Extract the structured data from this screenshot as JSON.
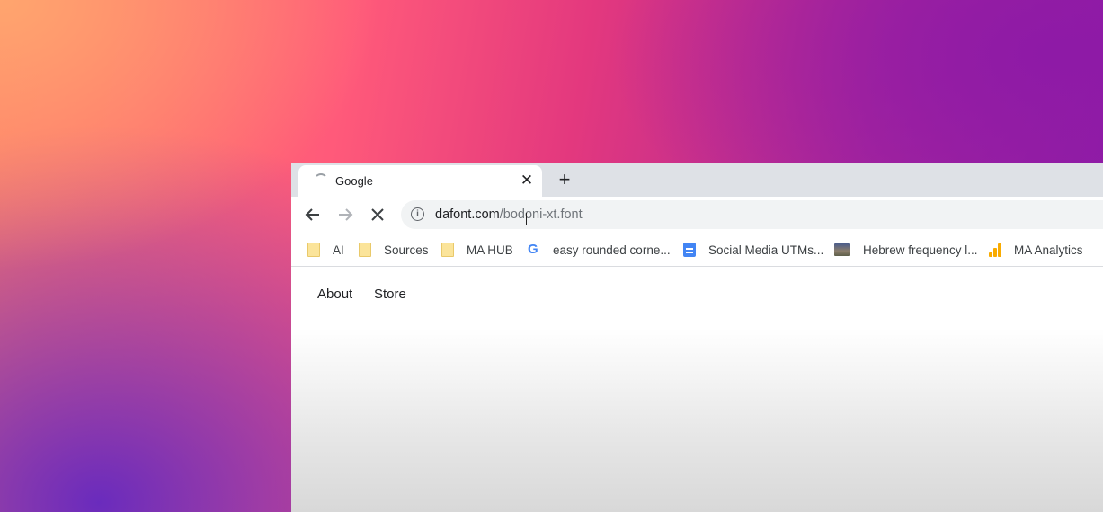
{
  "tab": {
    "title": "Google",
    "close_icon": "close-icon",
    "new_tab_icon": "plus-icon"
  },
  "toolbar": {
    "back_icon": "arrow-left-icon",
    "forward_icon": "arrow-right-icon",
    "stop_icon": "stop-loading-icon"
  },
  "omnibox": {
    "info_icon": "info-icon",
    "host": "dafont.com",
    "path": "/bodoni-xt.font"
  },
  "bookmarks": [
    {
      "label": "AI",
      "icon": "folder-icon"
    },
    {
      "label": "Sources",
      "icon": "folder-icon"
    },
    {
      "label": "MA HUB",
      "icon": "folder-icon"
    },
    {
      "label": "easy rounded corne...",
      "icon": "google-icon"
    },
    {
      "label": "Social Media UTMs...",
      "icon": "google-docs-icon"
    },
    {
      "label": "Hebrew frequency l...",
      "icon": "image-icon"
    },
    {
      "label": "MA Analytics",
      "icon": "analytics-icon"
    }
  ],
  "page": {
    "links": [
      "About",
      "Store"
    ]
  },
  "colors": {
    "tabstrip": "#dee1e6",
    "omnibox": "#f1f3f4",
    "google_blue": "#4285f4",
    "analytics_orange": "#f9ab00"
  }
}
